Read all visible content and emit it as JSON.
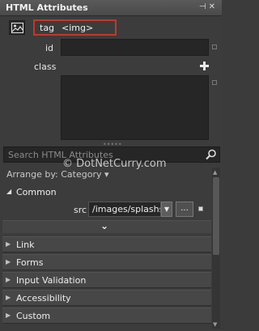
{
  "panel": {
    "title": "HTML Attributes",
    "title_buttons": "▾ ⊣ ✕"
  },
  "tag": {
    "label": "tag",
    "value": "<img>"
  },
  "fields": {
    "id_label": "id",
    "class_label": "class"
  },
  "search": {
    "placeholder": "Search HTML Attributes"
  },
  "arrange": {
    "label": "Arrange by: Category ▾"
  },
  "common": {
    "label": "Common",
    "src_label": "src",
    "src_value": "/images/splashs",
    "browse_label": "...",
    "expand_glyph": "⌄"
  },
  "sections": [
    {
      "label": "Link"
    },
    {
      "label": "Forms"
    },
    {
      "label": "Input Validation"
    },
    {
      "label": "Accessibility"
    },
    {
      "label": "Custom"
    }
  ],
  "watermark": "© DotNetCurry.com",
  "colors": {
    "highlight_box": "#c0392b",
    "panel_bg": "#3c3c3c"
  }
}
